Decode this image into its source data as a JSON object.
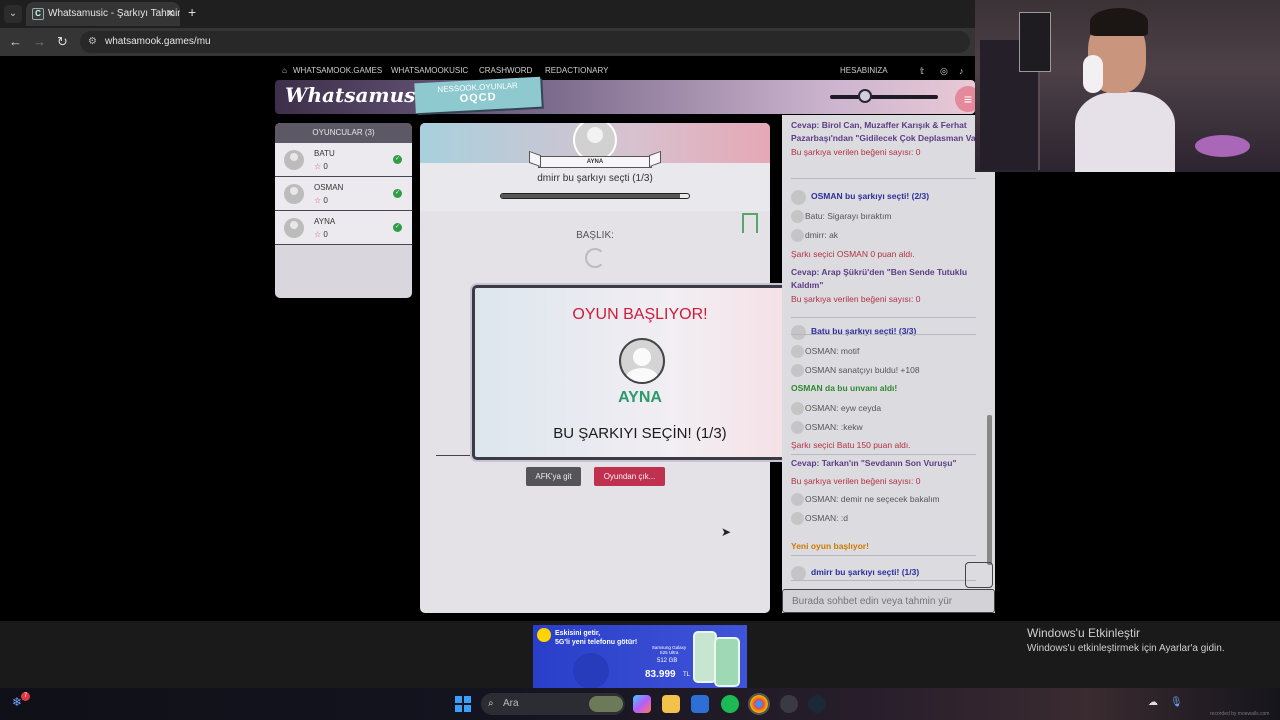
{
  "browser": {
    "tab_title": "Whatsamusic - Şarkıyı Tahmin Et",
    "tab_close": "✕",
    "new_tab": "+",
    "url": "whatsamook.games/mu"
  },
  "site_nav": {
    "items": [
      "WHATSAMOOK.GAMES",
      "WHATSAMOOKUSIC",
      "CRASHWORD",
      "REDACTIONARY"
    ],
    "account": "HESABINIZA"
  },
  "header": {
    "logo": "Whatsamusic",
    "badge_top": "NESSOOK.OYUNLAR",
    "badge_code": "OQCD",
    "menu_icon": "≡"
  },
  "players": {
    "title": "OYUNCULAR (3)",
    "list": [
      {
        "name": "BATU",
        "score": "0"
      },
      {
        "name": "OSMAN",
        "score": "0"
      },
      {
        "name": "AYNA",
        "score": "0"
      }
    ]
  },
  "game": {
    "picker_name": "AYNA",
    "status": "dmirr bu şarkıyı seçti (1/3)",
    "progress": 0.95,
    "baslik": "BAŞLIK:",
    "afk_button": "AFK'ya git",
    "quit_button": "Oyundan çık..."
  },
  "modal": {
    "title": "OYUN BAŞLIYOR!",
    "name": "AYNA",
    "message": "BU ŞARKIYI SEÇİN! (1/3)"
  },
  "chat": {
    "lines": [
      {
        "type": "ans",
        "text": "Cevap: Birol Can, Muzaffer Karışık & Ferhat Pazarbaşı'ndan \"Gidilecek Çok Deplasman Var\""
      },
      {
        "type": "likes",
        "text": "Bu şarkıya verilen beğeni sayısı: 0"
      },
      {
        "type": "pick",
        "text": "OSMAN bu şarkıyı seçti! (2/3)"
      },
      {
        "type": "msg",
        "text": "Batu: Sigarayı bıraktım"
      },
      {
        "type": "msg",
        "text": "dmirr: ak"
      },
      {
        "type": "sys",
        "text": "Şarkı seçici OSMAN 0 puan aldı."
      },
      {
        "type": "ans",
        "text": "Cevap: Arap Şükrü'den \"Ben Sende Tutuklu Kaldım\""
      },
      {
        "type": "likes",
        "text": "Bu şarkıya verilen beğeni sayısı: 0"
      },
      {
        "type": "pick",
        "text": "Batu bu şarkıyı seçti! (3/3)"
      },
      {
        "type": "msg",
        "text": "OSMAN: motif"
      },
      {
        "type": "msg",
        "text": "OSMAN sanatçıyı buldu! +108"
      },
      {
        "type": "found",
        "text": "OSMAN da bu unvanı aldı!"
      },
      {
        "type": "msg",
        "text": "OSMAN: eyw ceyda"
      },
      {
        "type": "msg",
        "text": "OSMAN: :kekw"
      },
      {
        "type": "sys",
        "text": "Şarkı seçici Batu 150 puan aldı."
      },
      {
        "type": "ans",
        "text": "Cevap: Tarkan'ın \"Sevdanın Son Vuruşu\""
      },
      {
        "type": "likes",
        "text": "Bu şarkıya verilen beğeni sayısı: 0"
      },
      {
        "type": "msg",
        "text": "OSMAN: demir ne seçecek bakalım"
      },
      {
        "type": "msg",
        "text": "OSMAN: :d"
      },
      {
        "type": "newg",
        "text": "Yeni oyun başlıyor!"
      },
      {
        "type": "pick",
        "text": "dmirr bu şarkıyı seçti! (1/3)"
      }
    ],
    "input_placeholder": "Burada sohbet edin veya tahmin yür"
  },
  "ad": {
    "line1": "Eskisini getir,",
    "line2": "5G'li yeni telefonu götür!",
    "model": "Samsung Galaxy S25 Ultra",
    "storage": "512 GB",
    "price": "83.999",
    "currency": "TL"
  },
  "windows": {
    "activate_title": "Windows'u Etkinleştir",
    "activate_sub": "Windows'u etkinleştirmek için Ayarlar'a gidin.",
    "search_placeholder": "Ara",
    "notification_count": "7",
    "recorded_by": "recorded by moewalls.com"
  }
}
